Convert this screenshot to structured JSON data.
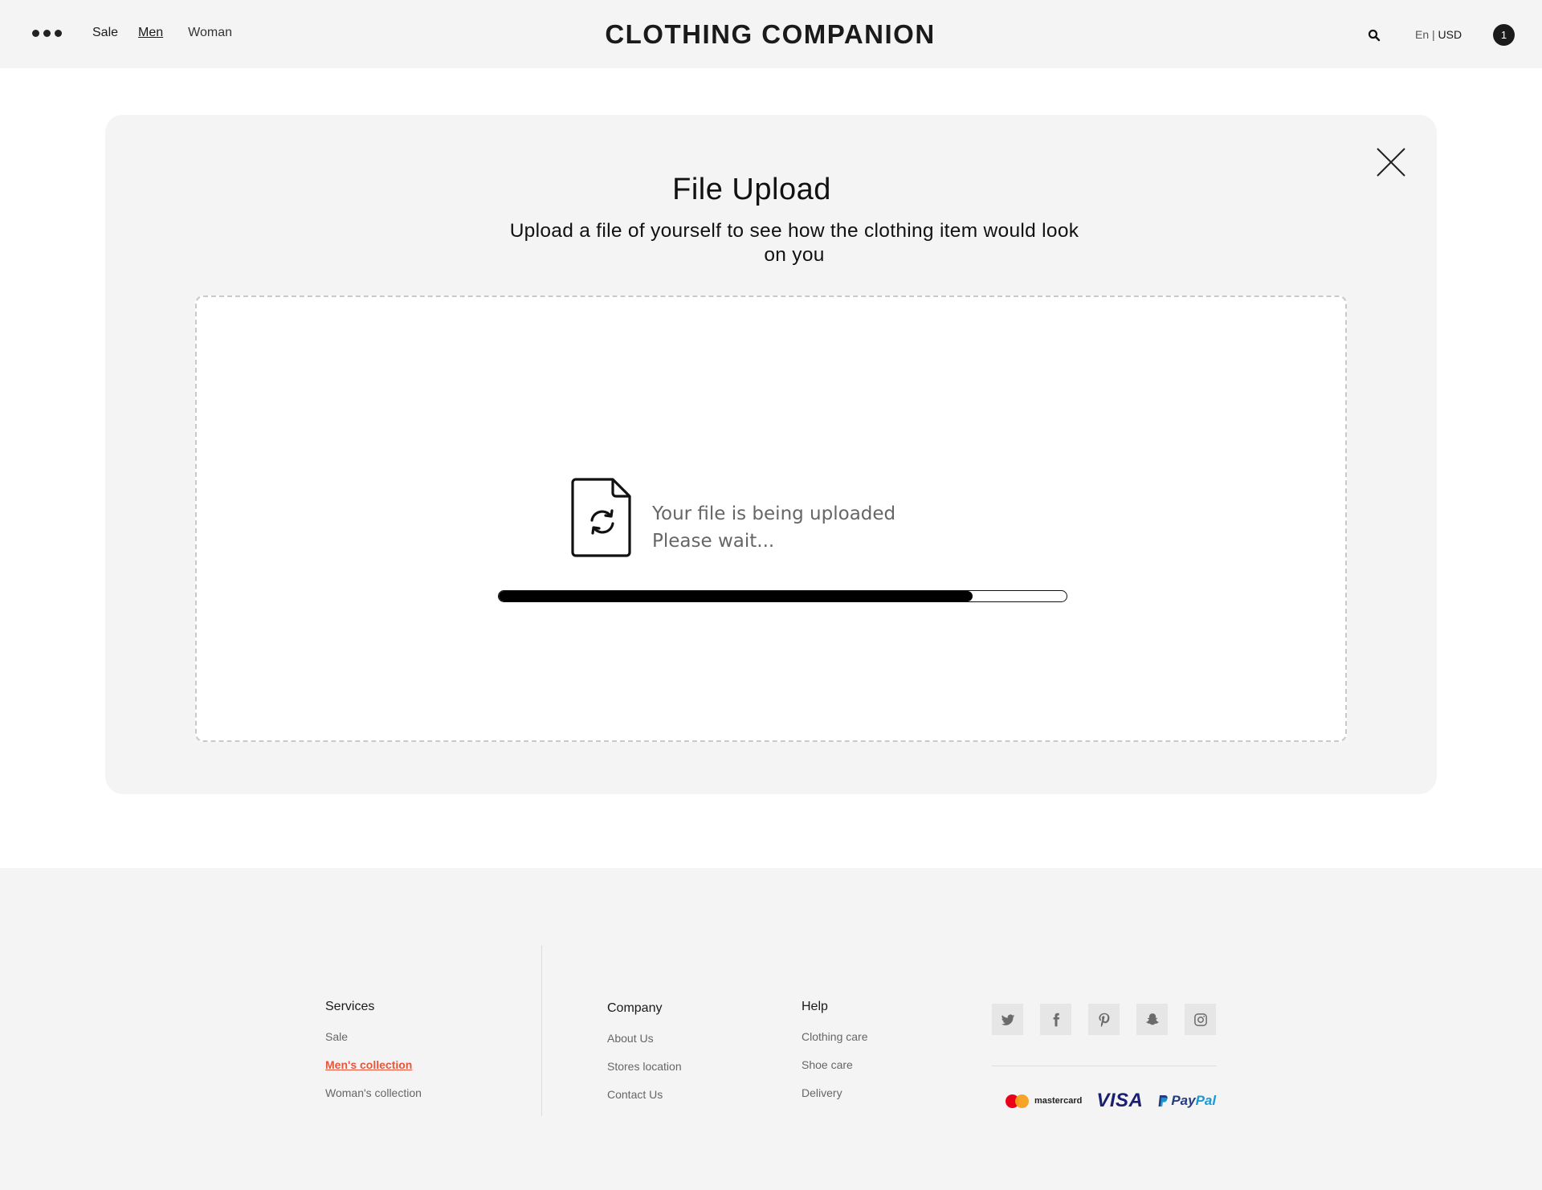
{
  "header": {
    "nav": [
      "Sale",
      "Men",
      "Woman"
    ],
    "brand": "CLOTHING COMPANION",
    "lang": "En",
    "currency": "USD",
    "cart_count": "1"
  },
  "modal": {
    "title": "File Upload",
    "subtitle": "Upload a file of yourself to see how the clothing item would look on you",
    "status_line1": "Your file is being uploaded",
    "status_line2": "Please wait...",
    "progress_fraction": 0.835
  },
  "footer": {
    "services": {
      "heading": "Services",
      "items": [
        "Sale",
        "Men's collection",
        "Woman's collection"
      ]
    },
    "company": {
      "heading": "Company",
      "items": [
        "About Us",
        "Stores location",
        "Contact Us"
      ]
    },
    "help": {
      "heading": "Help",
      "items": [
        "Clothing care",
        "Shoe care",
        "Delivery"
      ]
    },
    "social_icons": [
      "twitter-icon",
      "facebook-icon",
      "pinterest-icon",
      "snapchat-icon",
      "instagram-icon"
    ],
    "payments": {
      "mastercard": "mastercard",
      "visa": "VISA",
      "paypal_pay": "Pay",
      "paypal_pal": "Pal"
    }
  },
  "colors": {
    "accent": "#e8553a",
    "progress": "#000000",
    "panel": "#f4f4f4"
  }
}
